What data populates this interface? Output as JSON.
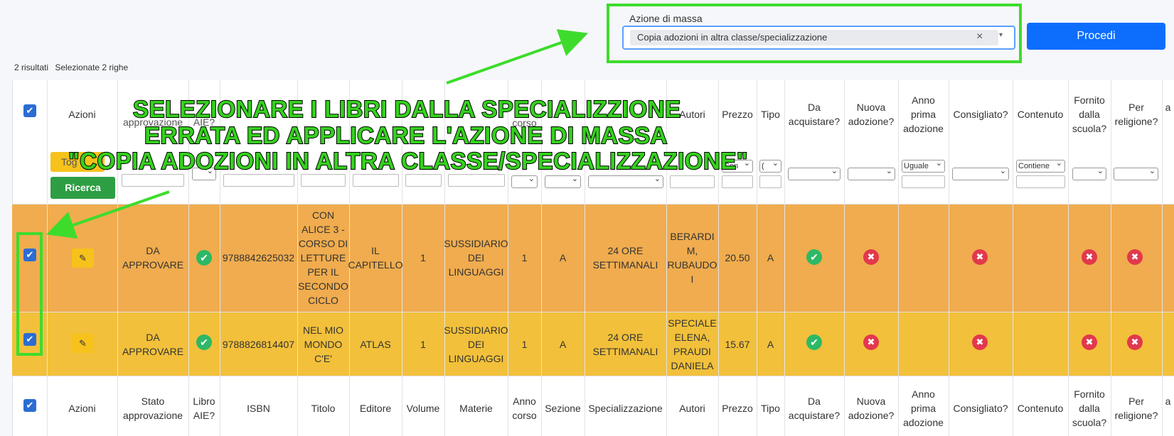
{
  "mass_action": {
    "label": "Azione di massa",
    "selected": "Copia adozioni in altra classe/specializzazione",
    "clear_glyph": "×",
    "caret_glyph": "▾",
    "submit": "Procedi"
  },
  "summary": {
    "results": "2 risultati",
    "selected": "Selezionate 2 righe"
  },
  "header": {
    "azioni": "Azioni",
    "hidden_stato": "approvazione",
    "hidden_libro": "AIE?",
    "anno_partial": "corso",
    "autori": "Autori",
    "prezzo": "Prezzo",
    "tipo": "Tipo",
    "da_acquistare": "Da acquistare?",
    "nuova_adozione": "Nuova adozione?",
    "anno_prima": "Anno prima adozione",
    "consigliato": "Consigliato?",
    "contenuto": "Contenuto",
    "fornito": "Fornito dalla scuola?",
    "religione": "Per religione?",
    "cut": "a"
  },
  "filters": {
    "toggle": "Tog",
    "ricerca": "Ricerca",
    "prezzo_op": "Con",
    "tipo_op": "(",
    "anno_prima_op": "Uguale",
    "contenuto_op": "Contiene"
  },
  "footer": {
    "azioni": "Azioni",
    "stato": "Stato approvazione",
    "libro": "Libro AIE?",
    "isbn": "ISBN",
    "titolo": "Titolo",
    "editore": "Editore",
    "volume": "Volume",
    "materie": "Materie",
    "anno": "Anno corso",
    "sezione": "Sezione",
    "spec": "Specializzazione",
    "autori": "Autori",
    "prezzo": "Prezzo",
    "tipo": "Tipo",
    "da_acquistare": "Da acquistare?",
    "nuova_adozione": "Nuova adozione?",
    "anno_prima": "Anno prima adozione",
    "consigliato": "Consigliato?",
    "contenuto": "Contenuto",
    "fornito": "Fornito dalla scuola?",
    "religione": "Per religione?",
    "cut": "a"
  },
  "rows": [
    {
      "stato": "DA APPROVARE",
      "isbn": "9788842625032",
      "titolo": "CON ALICE 3 - CORSO DI LETTURE PER IL SECONDO CICLO",
      "editore": "IL CAPITELLO",
      "volume": "1",
      "materie": "SUSSIDIARIO DEI LINGUAGGI",
      "anno": "1",
      "sezione": "A",
      "spec": "24 ORE SETTIMANALI",
      "autori": "BERARDI M, RUBAUDO I",
      "prezzo": "20.50",
      "tipo": "A"
    },
    {
      "stato": "DA APPROVARE",
      "isbn": "9788826814407",
      "titolo": "NEL MIO MONDO C'E'",
      "editore": "ATLAS",
      "volume": "1",
      "materie": "SUSSIDIARIO DEI LINGUAGGI",
      "anno": "1",
      "sezione": "A",
      "spec": "24 ORE SETTIMANALI",
      "autori": "SPECIALE ELENA, PRAUDI DANIELA",
      "prezzo": "15.67",
      "tipo": "A"
    }
  ],
  "annotation": {
    "line1": "SELEZIONARE I LIBRI DALLA SPECIALIZZIONE",
    "line2": "ERRATA ED APPLICARE L'AZIONE DI MASSA",
    "line3": "\"COPIA ADOZIONI IN ALTRA CLASSE/SPECIALIZZAZIONE\""
  },
  "colors": {
    "row_pending_1": "#f0ac4e",
    "row_pending_2": "#f2c03a",
    "annotation_green": "#3ddc2c",
    "primary": "#0d6efd"
  }
}
